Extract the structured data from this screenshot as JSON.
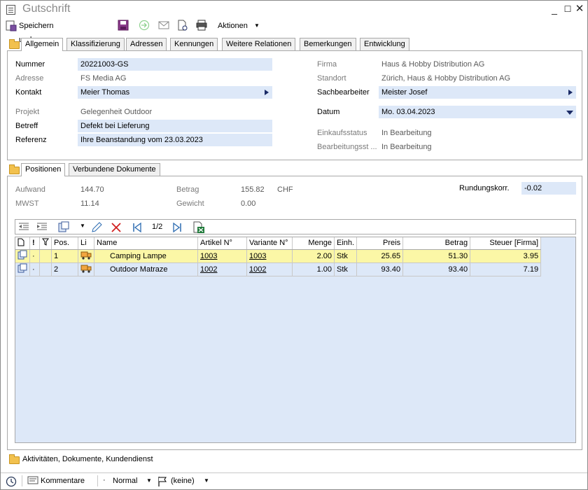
{
  "window": {
    "title": "Gutschrift"
  },
  "toolbar": {
    "save_close": "Speichern und schliessen",
    "actions": "Aktionen"
  },
  "tabs_top": [
    "Allgemein",
    "Klassifizierung",
    "Adressen",
    "Kennungen",
    "Weitere Relationen",
    "Bemerkungen",
    "Entwicklung"
  ],
  "general": {
    "nummer_label": "Nummer",
    "nummer": "20221003-GS",
    "adresse_label": "Adresse",
    "adresse": "FS Media AG",
    "kontakt_label": "Kontakt",
    "kontakt": "Meier Thomas",
    "projekt_label": "Projekt",
    "projekt": "Gelegenheit Outdoor",
    "betreff_label": "Betreff",
    "betreff": "Defekt bei Lieferung",
    "referenz_label": "Referenz",
    "referenz": "Ihre Beanstandung vom 23.03.2023",
    "firma_label": "Firma",
    "firma": "Haus & Hobby Distribution AG",
    "standort_label": "Standort",
    "standort": "Zürich, Haus & Hobby Distribution AG",
    "sachbearbeiter_label": "Sachbearbeiter",
    "sachbearbeiter": "Meister Josef",
    "datum_label": "Datum",
    "datum": "Mo. 03.04.2023",
    "einkaufsstatus_label": "Einkaufsstatus",
    "einkaufsstatus": "In Bearbeitung",
    "bearbeitungsstatus_label": "Bearbeitungsst ...",
    "bearbeitungsstatus": "In Bearbeitung"
  },
  "tabs_bottom": [
    "Positionen",
    "Verbundene Dokumente"
  ],
  "totals": {
    "aufwand_label": "Aufwand",
    "aufwand": "144.70",
    "mwst_label": "MWST",
    "mwst": "11.14",
    "betrag_label": "Betrag",
    "betrag": "155.82",
    "currency": "CHF",
    "gewicht_label": "Gewicht",
    "gewicht": "0.00",
    "rundung_label": "Rundungskorr.",
    "rundung": "-0.02"
  },
  "grid_toolbar": {
    "page": "1/2"
  },
  "grid": {
    "headers": [
      "",
      "!",
      "",
      "Pos.",
      "Li",
      "Name",
      "Artikel N°",
      "Variante N°",
      "Menge",
      "Einh.",
      "Preis",
      "Betrag",
      "Steuer [Firma]"
    ],
    "rows": [
      {
        "mark": "·",
        "pos": "1",
        "name": "Camping Lampe",
        "artikel": "1003",
        "variante": "1003",
        "menge": "2.00",
        "einh": "Stk",
        "preis": "25.65",
        "betrag": "51.30",
        "steuer": "3.95"
      },
      {
        "mark": "·",
        "pos": "2",
        "name": "Outdoor Matraze",
        "artikel": "1002",
        "variante": "1002",
        "menge": "1.00",
        "einh": "Stk",
        "preis": "93.40",
        "betrag": "93.40",
        "steuer": "7.19"
      }
    ]
  },
  "activities": {
    "label": "Aktivitäten, Dokumente, Kundendienst"
  },
  "status": {
    "comments": "Kommentare",
    "priority": "Normal",
    "flag": "(keine)"
  },
  "colors": {
    "field_bg": "#dde8f8",
    "selected_row": "#fbf7a6",
    "accent": "#1a2a66"
  }
}
